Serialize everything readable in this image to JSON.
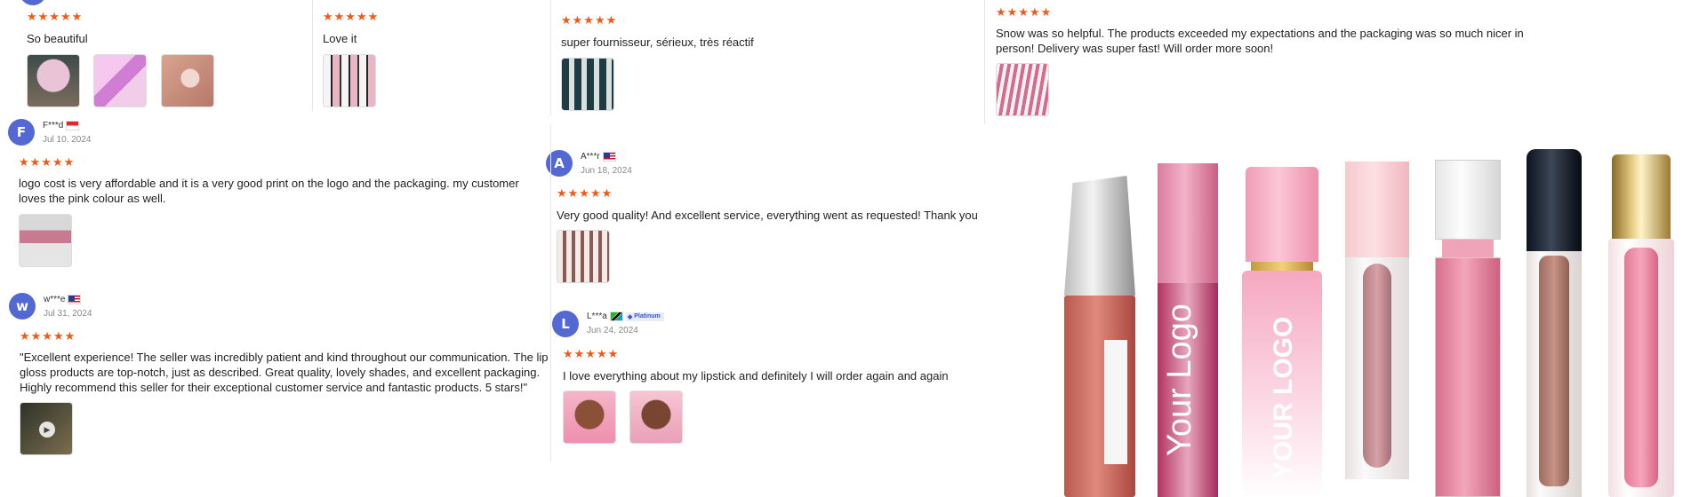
{
  "reviews": {
    "r1": {
      "stars": "★★★★★",
      "text": "So beautiful"
    },
    "r2": {
      "stars": "★★★★★",
      "text": "Love it"
    },
    "r3": {
      "stars": "★★★★★",
      "text": "super fournisseur, sérieux, très réactif"
    },
    "r4": {
      "stars": "★★★★★",
      "text": "Snow was so helpful. The products exceeded my expectations and the packaging was so much nicer in person! Delivery was super fast! Will order more soon!"
    },
    "r5": {
      "avatar": "F",
      "name": "F***d",
      "date": "Jul 10, 2024",
      "stars": "★★★★★",
      "text": "logo cost is very affordable and it is a very good print on the logo and the packaging. my customer loves the pink colour as well."
    },
    "r6": {
      "avatar": "A",
      "name": "A***r",
      "date": "Jun 18, 2024",
      "stars": "★★★★★",
      "text": "Very good quality! And excellent service, everything went as requested! Thank you"
    },
    "r7": {
      "avatar": "w",
      "name": "w***e",
      "date": "Jul 31, 2024",
      "stars": "★★★★★",
      "text": "\"Excellent experience! The seller was incredibly patient and kind throughout our communication. The lip gloss products are top-notch, just as described. Great quality, lovely shades, and excellent packaging. Highly recommend this seller for their exceptional customer service and fantastic products. 5 stars!\""
    },
    "r8": {
      "avatar": "L",
      "name": "L***a",
      "badge": "Platinum",
      "date": "Jun 24, 2024",
      "stars": "★★★★★",
      "text": "I love everything about my lipstick and definitely I will order again and again"
    }
  },
  "product": {
    "logo_text_1": "Your Logo",
    "logo_text_2": "YOUR LOGO"
  },
  "colors": {
    "star": "#f05a19",
    "avatar": "#5468d4"
  },
  "icons": {
    "play": "play-icon",
    "platinum": "diamond-icon"
  }
}
